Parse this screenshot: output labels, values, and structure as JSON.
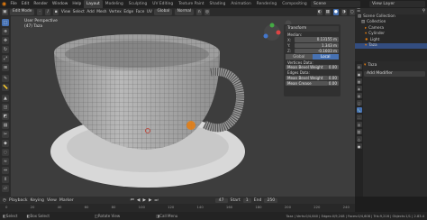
{
  "app": {
    "menus": [
      "File",
      "Edit",
      "Render",
      "Window",
      "Help"
    ],
    "workspaces": [
      "Layout",
      "Modeling",
      "Sculpting",
      "UV Editing",
      "Texture Paint",
      "Shading",
      "Animation",
      "Rendering",
      "Compositing",
      "Scripting"
    ],
    "scene": "Scene",
    "view_layer": "View Layer"
  },
  "view_header": {
    "mode": "Edit Mode",
    "menus": [
      "View",
      "Select",
      "Add",
      "Mesh",
      "Vertex",
      "Edge",
      "Face",
      "UV"
    ],
    "orientation": "Global",
    "snap": "Normal"
  },
  "viewport": {
    "view_name": "User Perspective",
    "object_label": "(47) Taza"
  },
  "npanel": {
    "transform_title": "Transform",
    "median_label": "Median:",
    "x_label": "X:",
    "x_value": "0.13155 m",
    "y_label": "Y:",
    "y_value": "1.343 m",
    "z_label": "Z:",
    "z_value": "-0.1603 m",
    "global_label": "Global",
    "local_label": "Local",
    "vertices_data": "Vertices Data:",
    "mean_bevel_weight_v": "Mean Bevel Weight",
    "v_bevel_value": "0.00",
    "edges_data": "Edges Data:",
    "mean_bevel_weight_e": "Mean Bevel Weight",
    "e_bevel_value": "0.00",
    "mean_crease": "Mean Crease",
    "crease_value": "0.00"
  },
  "outliner": {
    "title": "Scene Collection",
    "items": [
      {
        "label": "Scene Collection",
        "icon": "collection-icon"
      },
      {
        "label": "Collection",
        "icon": "collection-icon"
      },
      {
        "label": "Camera",
        "icon": "camera-icon"
      },
      {
        "label": "Cylinder",
        "icon": "mesh-icon"
      },
      {
        "label": "Light",
        "icon": "light-icon"
      },
      {
        "label": "Taza",
        "icon": "mesh-icon"
      }
    ]
  },
  "properties": {
    "object_name": "Taza",
    "add_modifier": "Add Modifier"
  },
  "timeline": {
    "menus": [
      "Playback",
      "Keying",
      "View",
      "Marker"
    ],
    "current_frame": "47",
    "start_label": "Start",
    "start_value": "1",
    "end_label": "End",
    "end_value": "250",
    "ruler": [
      "0",
      "20",
      "40",
      "60",
      "80",
      "100",
      "120",
      "140",
      "160",
      "180",
      "200",
      "220",
      "240"
    ]
  },
  "status": {
    "left_1": "Select",
    "left_2": "Box Select",
    "left_3": "Rotate View",
    "left_4": "Call Menu",
    "right": "Taza | Verts:0/4,640 | Edges:0/9,248 | Faces:0/4,608 | Tris:9,216 | Objects:1/1 | 2.83.4"
  },
  "colors": {
    "accent_blue": "#4772b3",
    "orange": "#e87d0d",
    "viewport_bg": "#3d3d3d"
  }
}
